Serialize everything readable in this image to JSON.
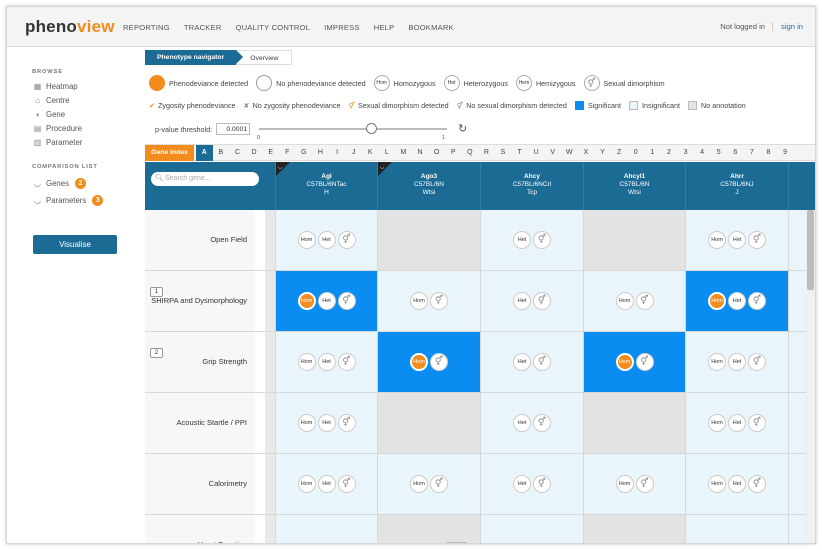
{
  "app": {
    "logo_a": "pheno",
    "logo_b": "view"
  },
  "nav": [
    "REPORTING",
    "TRACKER",
    "QUALITY CONTROL",
    "IMPRESS",
    "HELP",
    "BOOKMARK"
  ],
  "auth": {
    "status": "Not logged in",
    "signin": "sign in"
  },
  "sidebar": {
    "browse_heading": "BROWSE",
    "browse_items": [
      {
        "label": "Heatmap",
        "icon": "grid-icon"
      },
      {
        "label": "Centre",
        "icon": "building-icon"
      },
      {
        "label": "Gene",
        "icon": "mouse-icon"
      },
      {
        "label": "Procedure",
        "icon": "document-icon"
      },
      {
        "label": "Parameter",
        "icon": "bar-chart-icon"
      }
    ],
    "comparison_heading": "COMPARISON LIST",
    "comparison_items": [
      {
        "label": "Genes",
        "count": "2",
        "icon": "basket-icon"
      },
      {
        "label": "Parameters",
        "count": "3",
        "icon": "basket-icon"
      }
    ],
    "visualise": "Visualise"
  },
  "breadcrumb": {
    "current": "Phenotype navigator",
    "next": "Overview"
  },
  "legend": {
    "row1": [
      "Phenodeviance detected",
      "No phenodeviance detected",
      "Homozygous",
      "Heterozygous",
      "Hemizygous",
      "Sexual dimorphism"
    ],
    "row1_icons": [
      "Hom",
      "Het",
      "Hem"
    ],
    "row2": [
      "Zygosity phenodeviance",
      "No zygosity phenodeviance",
      "Sexual dimorphism detected",
      "No sexual dimorphism detected",
      "Significant",
      "Insignificant",
      "No annotation"
    ],
    "check": "✔",
    "cross": "✘"
  },
  "threshold": {
    "label": "p-value threshold:",
    "value": "0.0001",
    "min": "0",
    "max": "1"
  },
  "gene_index": {
    "label": "Gene index",
    "letters": [
      "A",
      "B",
      "C",
      "D",
      "E",
      "F",
      "G",
      "H",
      "I",
      "J",
      "K",
      "L",
      "M",
      "N",
      "O",
      "P",
      "Q",
      "R",
      "S",
      "T",
      "U",
      "V",
      "W",
      "X",
      "Y",
      "Z",
      "0",
      "1",
      "2",
      "3",
      "4",
      "5",
      "6",
      "7",
      "8",
      "9"
    ],
    "selected": "A"
  },
  "search": {
    "placeholder": "Search gene..."
  },
  "columns": [
    {
      "gene": "Agl",
      "strain": "C57BL/6NTac",
      "centre": "H",
      "marked": true
    },
    {
      "gene": "Ago3",
      "strain": "C57BL/6N",
      "centre": "Wtsi",
      "marked": true
    },
    {
      "gene": "Ahcy",
      "strain": "C57BL/6NCrl",
      "centre": "Tcp",
      "marked": false
    },
    {
      "gene": "Ahcyl1",
      "strain": "C57BL/6N",
      "centre": "Wtsi",
      "marked": false
    },
    {
      "gene": "Ahrr",
      "strain": "C57BL/6NJ",
      "centre": "J",
      "marked": false
    }
  ],
  "rows": [
    {
      "label": "Open Field",
      "num": "",
      "cells": [
        {
          "state": "c0",
          "pills": [
            "Hom",
            "Het",
            "sd"
          ],
          "hom_on": false
        },
        {
          "state": "c1",
          "pills": [],
          "hom_on": false
        },
        {
          "state": "c0",
          "pills": [
            "Het",
            "sd"
          ],
          "hom_on": false
        },
        {
          "state": "c1",
          "pills": [],
          "hom_on": false
        },
        {
          "state": "c0",
          "pills": [
            "Hom",
            "Het",
            "sd"
          ],
          "hom_on": false
        }
      ]
    },
    {
      "label": "SHIRPA and Dysmorphology",
      "num": "1",
      "cells": [
        {
          "state": "c2",
          "pills": [
            "Hom",
            "Het",
            "sd"
          ],
          "hom_on": true
        },
        {
          "state": "c0",
          "pills": [
            "Hom",
            "sd"
          ],
          "hom_on": false
        },
        {
          "state": "c0",
          "pills": [
            "Het",
            "sd"
          ],
          "hom_on": false
        },
        {
          "state": "c0",
          "pills": [
            "Hom",
            "sd"
          ],
          "hom_on": false
        },
        {
          "state": "c2",
          "pills": [
            "Hom",
            "Het",
            "sd"
          ],
          "hom_on": true
        }
      ]
    },
    {
      "label": "Grip Strength",
      "num": "2",
      "cells": [
        {
          "state": "c0",
          "pills": [
            "Hom",
            "Het",
            "sd"
          ],
          "hom_on": false
        },
        {
          "state": "c2",
          "pills": [
            "Hom",
            "sd"
          ],
          "hom_on": true
        },
        {
          "state": "c0",
          "pills": [
            "Het",
            "sd"
          ],
          "hom_on": false
        },
        {
          "state": "c2",
          "pills": [
            "Hom",
            "sd"
          ],
          "hom_on": true
        },
        {
          "state": "c0",
          "pills": [
            "Hom",
            "Het",
            "sd"
          ],
          "hom_on": false
        }
      ]
    },
    {
      "label": "Acoustic Startle / PPI",
      "num": "",
      "cells": [
        {
          "state": "c0",
          "pills": [
            "Hom",
            "Het",
            "sd"
          ],
          "hom_on": false
        },
        {
          "state": "c1",
          "pills": [],
          "hom_on": false
        },
        {
          "state": "c0",
          "pills": [
            "Het",
            "sd"
          ],
          "hom_on": false
        },
        {
          "state": "c1",
          "pills": [],
          "hom_on": false
        },
        {
          "state": "c0",
          "pills": [
            "Hom",
            "Het",
            "sd"
          ],
          "hom_on": false
        }
      ]
    },
    {
      "label": "Calorimetry",
      "num": "",
      "cells": [
        {
          "state": "c0",
          "pills": [
            "Hom",
            "Het",
            "sd"
          ],
          "hom_on": false
        },
        {
          "state": "c0",
          "pills": [
            "Hom",
            "sd"
          ],
          "hom_on": false
        },
        {
          "state": "c0",
          "pills": [
            "Het",
            "sd"
          ],
          "hom_on": false
        },
        {
          "state": "c0",
          "pills": [
            "Hom",
            "sd"
          ],
          "hom_on": false
        },
        {
          "state": "c0",
          "pills": [
            "Hom",
            "Het",
            "sd"
          ],
          "hom_on": false
        }
      ]
    },
    {
      "label": "Heart Function",
      "num": "",
      "cells": [
        {
          "state": "c0",
          "pills": [],
          "hom_on": false
        },
        {
          "state": "c1",
          "pills": [],
          "hom_on": false
        },
        {
          "state": "c0",
          "pills": [],
          "hom_on": false
        },
        {
          "state": "c1",
          "pills": [],
          "hom_on": false
        },
        {
          "state": "c0",
          "pills": [],
          "hom_on": false
        }
      ]
    }
  ],
  "colors": {
    "brand_blue": "#1c6b94",
    "accent_orange": "#f28c1c",
    "significant": "#0a8cf0"
  }
}
